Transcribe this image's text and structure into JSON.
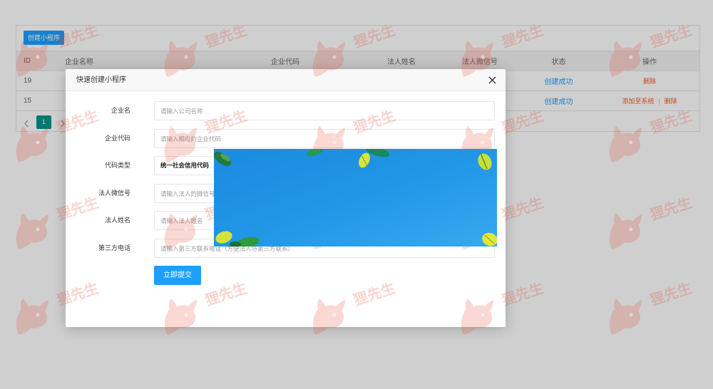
{
  "toolbar": {
    "create_button": "创建小程序"
  },
  "table": {
    "columns": [
      "ID",
      "企业名称",
      "企业代码",
      "法人姓名",
      "法人微信号",
      "状态",
      "操作"
    ],
    "rows": [
      {
        "id": "19",
        "status": "创建成功",
        "actions": [
          "删除"
        ]
      },
      {
        "id": "15",
        "status": "创建成功",
        "actions": [
          "添加至系统",
          "删除"
        ]
      }
    ],
    "action_separator": "|"
  },
  "pagination": {
    "current_page": "1"
  },
  "modal": {
    "title": "快速创建小程序",
    "fields": [
      {
        "label": "企业名",
        "placeholder": "请输入公司名称"
      },
      {
        "label": "企业代码",
        "placeholder": "请输入相应的企业代码"
      },
      {
        "label": "代码类型",
        "value": "统一社会信用代码"
      },
      {
        "label": "法人微信号",
        "placeholder": "请输入法人的微信号"
      },
      {
        "label": "法人姓名",
        "placeholder": "请输入法人姓名"
      },
      {
        "label": "第三方电话",
        "placeholder": "请输入第三方联系电话（方便法人与第三方联系）"
      }
    ],
    "submit_button": "立即提交"
  },
  "watermark": {
    "text": "狸先生"
  },
  "icons": {
    "close": "close-icon",
    "prev_page": "chevron-left-icon",
    "next_page": "chevron-right-icon",
    "watermark_logo": "fox-logo-icon"
  },
  "colors": {
    "primary": "#1E9FFF",
    "danger": "#FF5722",
    "pagination_active": "#009688",
    "banner_sky": "#2196E6"
  }
}
